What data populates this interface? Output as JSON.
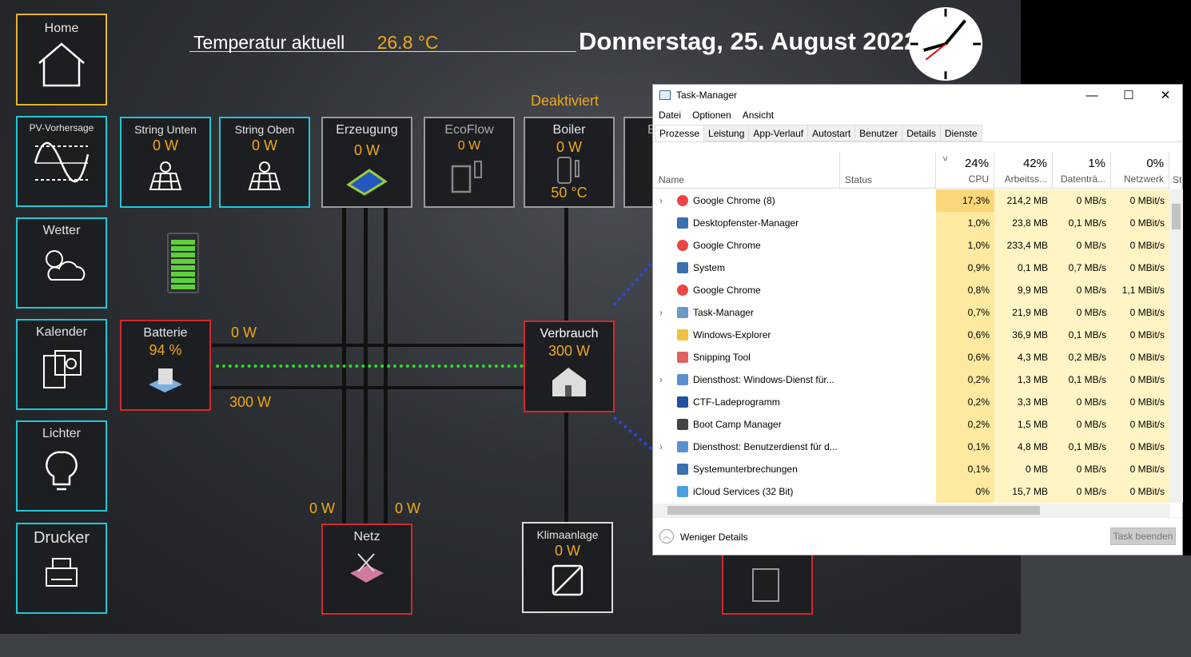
{
  "header": {
    "temp_label": "Temperatur aktuell",
    "temp_value": "26.8 °C",
    "date": "Donnerstag, 25. August 2022",
    "status": "Deaktiviert"
  },
  "sidebar": [
    {
      "label": "Home",
      "icon": "home-icon"
    },
    {
      "label": "PV-Vorhersage",
      "icon": "sine-wave-icon"
    },
    {
      "label": "Wetter",
      "icon": "sun-cloud-icon"
    },
    {
      "label": "Kalender",
      "icon": "calendar-icon"
    },
    {
      "label": "Lichter",
      "icon": "lightbulb-icon"
    },
    {
      "label": "Drucker",
      "icon": "printer-icon"
    }
  ],
  "tiles": {
    "string_unten": {
      "label": "String Unten",
      "value": "0 W"
    },
    "string_oben": {
      "label": "String Oben",
      "value": "0 W"
    },
    "erzeugung": {
      "label": "Erzeugung",
      "value": "0 W"
    },
    "ecoflow": {
      "label": "EcoFlow",
      "value": "0 W"
    },
    "boiler": {
      "label": "Boiler",
      "value": "0 W",
      "temp": "50 °C"
    },
    "partial": {
      "label": "E"
    },
    "batterie": {
      "label": "Batterie",
      "value": "94 %"
    },
    "verbrauch": {
      "label": "Verbrauch",
      "value": "300 W"
    },
    "netz": {
      "label": "Netz"
    },
    "klima": {
      "label": "Klimaanlage",
      "value": "0 W"
    }
  },
  "flows": {
    "bat_out": "0 W",
    "bat_in": "300 W",
    "netz_left": "0 W",
    "netz_right": "0 W"
  },
  "battery_level": 94,
  "taskmanager": {
    "title": "Task-Manager",
    "menu": [
      "Datei",
      "Optionen",
      "Ansicht"
    ],
    "tabs": [
      "Prozesse",
      "Leistung",
      "App-Verlauf",
      "Autostart",
      "Benutzer",
      "Details",
      "Dienste"
    ],
    "columns": {
      "name": "Name",
      "status": "Status",
      "cpu_pct": "24%",
      "cpu": "CPU",
      "mem_pct": "42%",
      "mem": "Arbeitss...",
      "disk_pct": "1%",
      "disk": "Datenträ...",
      "net_pct": "0%",
      "net": "Netzwerk",
      "extra": "St"
    },
    "rows": [
      {
        "name": "Google Chrome (8)",
        "cpu": "17,3%",
        "mem": "214,2 MB",
        "disk": "0 MB/s",
        "net": "0 MBit/s",
        "exp": true,
        "icon": "chrome"
      },
      {
        "name": "Desktopfenster-Manager",
        "cpu": "1,0%",
        "mem": "23,8 MB",
        "disk": "0,1 MB/s",
        "net": "0 MBit/s",
        "icon": "win"
      },
      {
        "name": "Google Chrome",
        "cpu": "1,0%",
        "mem": "233,4 MB",
        "disk": "0 MB/s",
        "net": "0 MBit/s",
        "icon": "chrome"
      },
      {
        "name": "System",
        "cpu": "0,9%",
        "mem": "0,1 MB",
        "disk": "0,7 MB/s",
        "net": "0 MBit/s",
        "icon": "win"
      },
      {
        "name": "Google Chrome",
        "cpu": "0,8%",
        "mem": "9,9 MB",
        "disk": "0 MB/s",
        "net": "1,1 MBit/s",
        "icon": "chrome"
      },
      {
        "name": "Task-Manager",
        "cpu": "0,7%",
        "mem": "21,9 MB",
        "disk": "0 MB/s",
        "net": "0 MBit/s",
        "exp": true,
        "icon": "tm"
      },
      {
        "name": "Windows-Explorer",
        "cpu": "0,6%",
        "mem": "36,9 MB",
        "disk": "0,1 MB/s",
        "net": "0 MBit/s",
        "icon": "folder"
      },
      {
        "name": "Snipping Tool",
        "cpu": "0,6%",
        "mem": "4,3 MB",
        "disk": "0,2 MB/s",
        "net": "0 MBit/s",
        "icon": "snip"
      },
      {
        "name": "Diensthost: Windows-Dienst für...",
        "cpu": "0,2%",
        "mem": "1,3 MB",
        "disk": "0,1 MB/s",
        "net": "0 MBit/s",
        "exp": true,
        "icon": "gear"
      },
      {
        "name": "CTF-Ladeprogramm",
        "cpu": "0,2%",
        "mem": "3,3 MB",
        "disk": "0 MB/s",
        "net": "0 MBit/s",
        "icon": "pen"
      },
      {
        "name": "Boot Camp Manager",
        "cpu": "0,2%",
        "mem": "1,5 MB",
        "disk": "0 MB/s",
        "net": "0 MBit/s",
        "icon": "diamond"
      },
      {
        "name": "Diensthost: Benutzerdienst für d...",
        "cpu": "0,1%",
        "mem": "4,8 MB",
        "disk": "0,1 MB/s",
        "net": "0 MBit/s",
        "exp": true,
        "icon": "gear"
      },
      {
        "name": "Systemunterbrechungen",
        "cpu": "0,1%",
        "mem": "0 MB",
        "disk": "0 MB/s",
        "net": "0 MBit/s",
        "icon": "win"
      },
      {
        "name": "iCloud Services (32 Bit)",
        "cpu": "0%",
        "mem": "15,7 MB",
        "disk": "0 MB/s",
        "net": "0 MBit/s",
        "icon": "cloud"
      }
    ],
    "less_details": "Weniger Details",
    "end_task": "Task beenden"
  }
}
